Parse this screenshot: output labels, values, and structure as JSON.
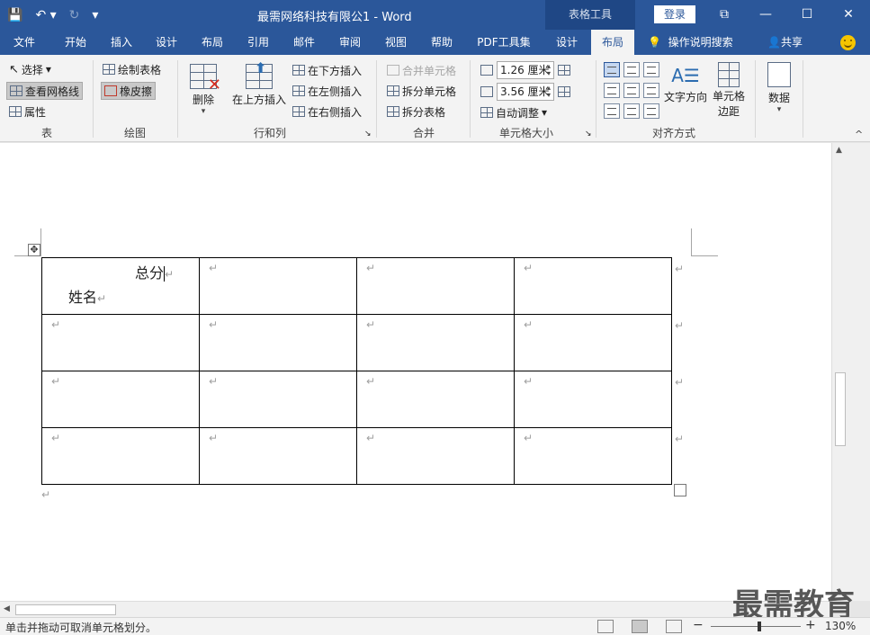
{
  "titlebar": {
    "doc_title": "最需网络科技有限公1  -  Word",
    "context_tab_header": "表格工具",
    "login": "登录",
    "qat": {
      "save": "💾",
      "undo": "↶ ▾",
      "redo": "↻",
      "customize": "▾"
    },
    "controls": {
      "ribbon_display": "⧉",
      "minimize": "—",
      "maximize": "☐",
      "close": "✕"
    }
  },
  "tabs": {
    "file": "文件",
    "home": "开始",
    "insert": "插入",
    "design": "设计",
    "layout": "布局",
    "references": "引用",
    "mailings": "邮件",
    "review": "审阅",
    "view": "视图",
    "help": "帮助",
    "pdf": "PDF工具集",
    "table_design": "设计",
    "table_layout": "布局",
    "tell_me": "操作说明搜索",
    "share": "共享"
  },
  "ribbon": {
    "table": {
      "select": "选择",
      "view_gridlines": "查看网格线",
      "properties": "属性",
      "label": "表"
    },
    "draw": {
      "draw_table": "绘制表格",
      "eraser": "橡皮擦",
      "label": "绘图"
    },
    "rows_cols": {
      "delete": "删除",
      "insert_above": "在上方插入",
      "insert_below": "在下方插入",
      "insert_left": "在左侧插入",
      "insert_right": "在右侧插入",
      "label": "行和列"
    },
    "merge": {
      "merge_cells": "合并单元格",
      "split_cells": "拆分单元格",
      "split_table": "拆分表格",
      "label": "合并"
    },
    "cell_size": {
      "height": "1.26 厘米",
      "width": "3.56 厘米",
      "autofit": "自动调整",
      "label": "单元格大小"
    },
    "alignment": {
      "text_direction": "文字方向",
      "cell_margins_1": "单元格",
      "cell_margins_2": "边距",
      "label": "对齐方式"
    },
    "data": {
      "data": "数据"
    },
    "collapse": "^"
  },
  "document": {
    "header_top": "总分",
    "header_bottom": "姓名",
    "para_mark": "↵",
    "move_handle": "✥"
  },
  "watermark": "最需教育",
  "status": {
    "hint": "单击并拖动可取消单元格划分。",
    "zoom_minus": "−",
    "zoom_plus": "+",
    "zoom_level": "130%"
  }
}
